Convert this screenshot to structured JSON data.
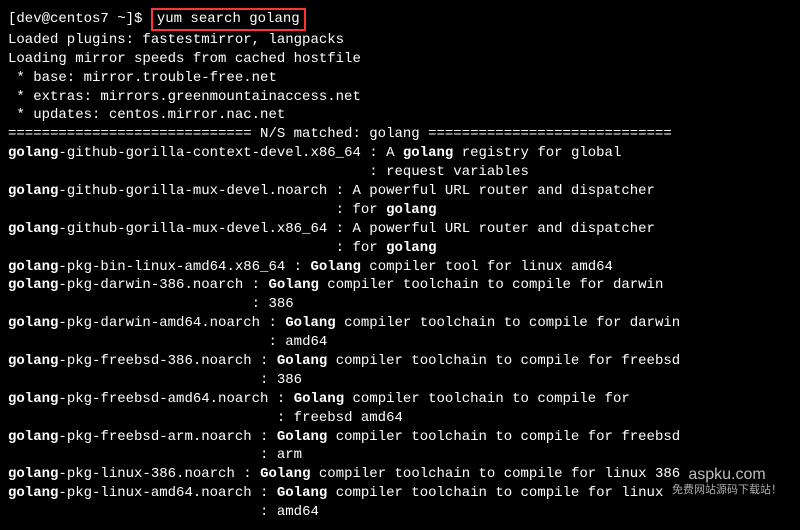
{
  "prompt": {
    "user_host": "[dev@centos7 ~]$ ",
    "command": "yum search golang"
  },
  "header_lines": [
    "Loaded plugins: fastestmirror, langpacks",
    "Loading mirror speeds from cached hostfile",
    " * base: mirror.trouble-free.net",
    " * extras: mirrors.greenmountainaccess.net",
    " * updates: centos.mirror.nac.net"
  ],
  "section": {
    "rule_left": "============================= ",
    "label": "N/S matched: golang",
    "rule_right": " ============================="
  },
  "results": [
    {
      "pkg_pre": "",
      "pkg_hl": "golang",
      "pkg_post": "-github-gorilla-context-devel.x86_64",
      "sep": " : ",
      "desc_pre": "A ",
      "desc_hl": "golang",
      "desc_post": " registry for global",
      "cont_spaces": "                                          ",
      "cont_sep": " : ",
      "cont_text": "request variables"
    },
    {
      "pkg_pre": "",
      "pkg_hl": "golang",
      "pkg_post": "-github-gorilla-mux-devel.noarch",
      "sep": " : ",
      "desc_pre": "A powerful URL router and dispatcher",
      "desc_hl": "",
      "desc_post": "",
      "cont_spaces": "                                      ",
      "cont_sep": " : ",
      "cont_pre": "for ",
      "cont_hl": "golang",
      "cont_post": ""
    },
    {
      "pkg_pre": "",
      "pkg_hl": "golang",
      "pkg_post": "-github-gorilla-mux-devel.x86_64",
      "sep": " : ",
      "desc_pre": "A powerful URL router and dispatcher",
      "desc_hl": "",
      "desc_post": "",
      "cont_spaces": "                                      ",
      "cont_sep": " : ",
      "cont_pre": "for ",
      "cont_hl": "golang",
      "cont_post": ""
    },
    {
      "pkg_pre": "",
      "pkg_hl": "golang",
      "pkg_post": "-pkg-bin-linux-amd64.x86_64",
      "sep": " : ",
      "desc_pre": "",
      "desc_hl": "Golang",
      "desc_post": " compiler tool for linux amd64"
    },
    {
      "pkg_pre": "",
      "pkg_hl": "golang",
      "pkg_post": "-pkg-darwin-386.noarch",
      "sep": " : ",
      "desc_pre": "",
      "desc_hl": "Golang",
      "desc_post": " compiler toolchain to compile for darwin",
      "cont_spaces": "                            ",
      "cont_sep": " : ",
      "cont_text": "386"
    },
    {
      "pkg_pre": "",
      "pkg_hl": "golang",
      "pkg_post": "-pkg-darwin-amd64.noarch",
      "sep": " : ",
      "desc_pre": "",
      "desc_hl": "Golang",
      "desc_post": " compiler toolchain to compile for darwin",
      "cont_spaces": "                              ",
      "cont_sep": " : ",
      "cont_text": "amd64"
    },
    {
      "pkg_pre": "",
      "pkg_hl": "golang",
      "pkg_post": "-pkg-freebsd-386.noarch",
      "sep": " : ",
      "desc_pre": "",
      "desc_hl": "Golang",
      "desc_post": " compiler toolchain to compile for freebsd",
      "cont_spaces": "                             ",
      "cont_sep": " : ",
      "cont_text": "386"
    },
    {
      "pkg_pre": "",
      "pkg_hl": "golang",
      "pkg_post": "-pkg-freebsd-amd64.noarch",
      "sep": " : ",
      "desc_pre": "",
      "desc_hl": "Golang",
      "desc_post": " compiler toolchain to compile for",
      "cont_spaces": "                               ",
      "cont_sep": " : ",
      "cont_text": "freebsd amd64"
    },
    {
      "pkg_pre": "",
      "pkg_hl": "golang",
      "pkg_post": "-pkg-freebsd-arm.noarch",
      "sep": " : ",
      "desc_pre": "",
      "desc_hl": "Golang",
      "desc_post": " compiler toolchain to compile for freebsd",
      "cont_spaces": "                             ",
      "cont_sep": " : ",
      "cont_text": "arm"
    },
    {
      "pkg_pre": "",
      "pkg_hl": "golang",
      "pkg_post": "-pkg-linux-386.noarch",
      "sep": " : ",
      "desc_pre": "",
      "desc_hl": "Golang",
      "desc_post": " compiler toolchain to compile for linux 386"
    },
    {
      "pkg_pre": "",
      "pkg_hl": "golang",
      "pkg_post": "-pkg-linux-amd64.noarch",
      "sep": " : ",
      "desc_pre": "",
      "desc_hl": "Golang",
      "desc_post": " compiler toolchain to compile for linux",
      "cont_spaces": "                             ",
      "cont_sep": " : ",
      "cont_text": "amd64"
    }
  ],
  "watermark": {
    "main": "aspku.com",
    "sub": "免费网站源码下载站！"
  }
}
